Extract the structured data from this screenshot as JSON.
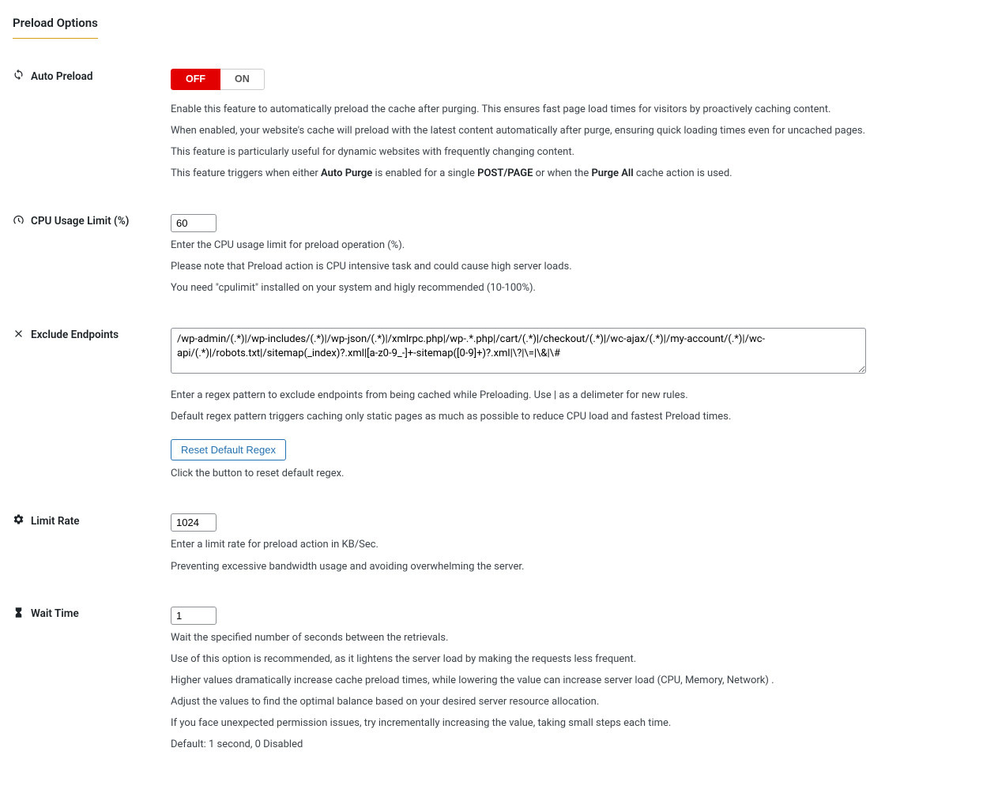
{
  "section_title": "Preload Options",
  "auto_preload": {
    "label": "Auto Preload",
    "off": "OFF",
    "on": "ON",
    "desc1": "Enable this feature to automatically preload the cache after purging. This ensures fast page load times for visitors by proactively caching content.",
    "desc2": "When enabled, your website's cache will preload with the latest content automatically after purge, ensuring quick loading times even for uncached pages.",
    "desc3": "This feature is particularly useful for dynamic websites with frequently changing content.",
    "desc4_pre": "This feature triggers when either ",
    "desc4_b1": "Auto Purge",
    "desc4_mid1": " is enabled for a single ",
    "desc4_b2": "POST/PAGE",
    "desc4_mid2": " or when the ",
    "desc4_b3": "Purge All",
    "desc4_post": " cache action is used."
  },
  "cpu_limit": {
    "label": "CPU Usage Limit (%)",
    "value": "60",
    "desc1": "Enter the CPU usage limit for preload operation (%).",
    "desc2": "Please note that Preload action is CPU intensive task and could cause high server loads.",
    "desc3": "You need \"cpulimit\" installed on your system and higly recommended (10-100%)."
  },
  "exclude_endpoints": {
    "label": "Exclude Endpoints",
    "value": "/wp-admin/(.*)|/wp-includes/(.*)|/wp-json/(.*)|/xmlrpc.php|/wp-.*.php|/cart/(.*)|/checkout/(.*)|/wc-ajax/(.*)|/my-account/(.*)|/wc-api/(.*)|/robots.txt|/sitemap(_index)?.xml|[a-z0-9_-]+-sitemap([0-9]+)?.xml|\\?|\\=|\\&|\\#",
    "desc1": "Enter a regex pattern to exclude endpoints from being cached while Preloading. Use | as a delimeter for new rules.",
    "desc2": "Default regex pattern triggers caching only static pages as much as possible to reduce CPU load and fastest Preload times.",
    "reset_btn": "Reset Default Regex",
    "desc3": "Click the button to reset default regex."
  },
  "limit_rate": {
    "label": "Limit Rate",
    "value": "1024",
    "desc1": "Enter a limit rate for preload action in KB/Sec.",
    "desc2": "Preventing excessive bandwidth usage and avoiding overwhelming the server."
  },
  "wait_time": {
    "label": "Wait Time",
    "value": "1",
    "desc1": "Wait the specified number of seconds between the retrievals.",
    "desc2": "Use of this option is recommended, as it lightens the server load by making the requests less frequent.",
    "desc3": "Higher values dramatically increase cache preload times, while lowering the value can increase server load (CPU, Memory, Network) .",
    "desc4": "Adjust the values to find the optimal balance based on your desired server resource allocation.",
    "desc5": "If you face unexpected permission issues, try incrementally increasing the value, taking small steps each time.",
    "desc6": "Default: 1 second, 0 Disabled"
  }
}
